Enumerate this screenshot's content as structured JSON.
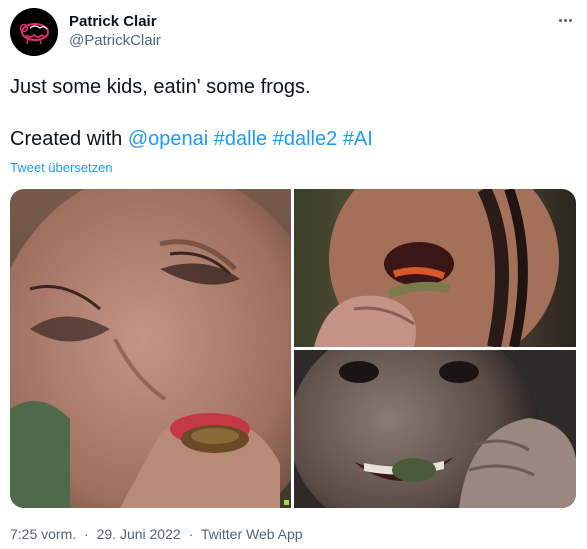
{
  "author": {
    "display_name": "Patrick Clair",
    "handle": "@PatrickClair",
    "avatar_icon": "sheep-avatar-icon"
  },
  "tweet": {
    "line1": "Just some kids, eatin' some frogs.",
    "created_with": "Created with",
    "mention": "@openai",
    "hashtags": [
      "#dalle",
      "#dalle2",
      "#AI"
    ],
    "translate_link": "Tweet übersetzen"
  },
  "media": {
    "images": [
      {
        "name": "child-eating-frog-closeup"
      },
      {
        "name": "child-biting-frog-profile"
      },
      {
        "name": "child-smiling-with-frog"
      }
    ]
  },
  "meta": {
    "time": "7:25 vorm.",
    "separator": "·",
    "date": "29. Juni 2022",
    "app": "Twitter Web App"
  },
  "colors": {
    "link": "#1d9bf0",
    "secondary_text": "#536471",
    "primary_text": "#0f1419"
  }
}
